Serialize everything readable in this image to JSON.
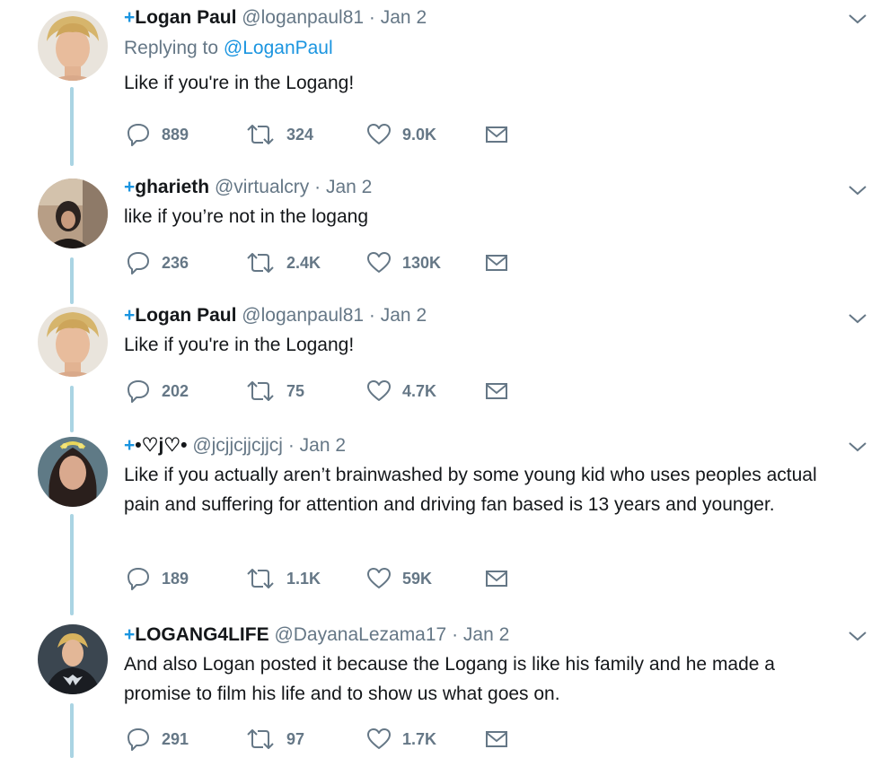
{
  "tweets": [
    {
      "plus": "+",
      "name": "Logan Paul",
      "handle": "@loganpaul81",
      "sep": "·",
      "date": "Jan 2",
      "reply_prefix": "Replying to",
      "reply_handle": "@LoganPaul",
      "text": "Like if you're in the Logang!",
      "replies": "889",
      "retweets": "324",
      "likes": "9.0K",
      "avatar": "blond-young-man-portrait"
    },
    {
      "plus": "+",
      "name": "gharieth",
      "handle": "@virtualcry",
      "sep": "·",
      "date": "Jan 2",
      "text": "like if you’re not in the logang",
      "replies": "236",
      "retweets": "2.4K",
      "likes": "130K",
      "avatar": "dark-haired-person-selfie"
    },
    {
      "plus": "+",
      "name": "Logan Paul",
      "handle": "@loganpaul81",
      "sep": "·",
      "date": "Jan 2",
      "text": "Like if you're in the Logang!",
      "replies": "202",
      "retweets": "75",
      "likes": "4.7K",
      "avatar": "blond-young-man-portrait"
    },
    {
      "plus": "+",
      "name": "•♡j♡•",
      "handle": "@jcjjcjjcjjcj",
      "sep": "·",
      "date": "Jan 2",
      "text": "Like if you actually aren’t brainwashed by some young kid who uses peoples actual pain and suffering for attention and driving fan based is 13 years and younger.",
      "replies": "189",
      "retweets": "1.1K",
      "likes": "59K",
      "avatar": "long-haired-woman-selfie"
    },
    {
      "plus": "+",
      "name": "LOGANG4LIFE",
      "handle": "@DayanaLezama17",
      "sep": "·",
      "date": "Jan 2",
      "text": "And also Logan posted it because the Logang is like his family and he made a promise to film his life and to show us what goes on.",
      "replies": "291",
      "retweets": "97",
      "likes": "1.7K",
      "avatar": "blond-man-dark-shirt-logo"
    }
  ],
  "icons": {
    "reply": "reply-icon",
    "retweet": "retweet-icon",
    "like": "heart-icon",
    "message": "envelope-icon",
    "caret": "chevron-down-icon"
  },
  "colors": {
    "thread_line": "#aad4e3",
    "accent": "#1b95e0",
    "secondary_text": "#657786"
  }
}
